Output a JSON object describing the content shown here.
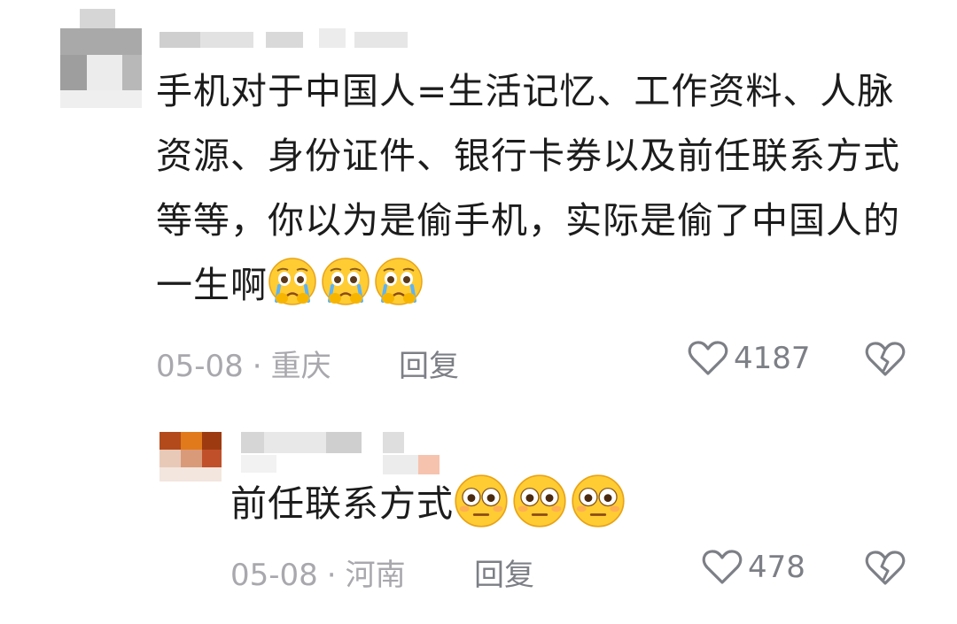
{
  "comments": [
    {
      "text": "手机对于中国人=生活记忆、工作资料、人脉资源、身份证件、银行卡券以及前任联系方式等等，你以为是偷手机，实际是偷了中国人的一生啊",
      "emoji": [
        "crying-pleading-face",
        "crying-pleading-face",
        "crying-pleading-face"
      ],
      "date": "05-08",
      "location": "重庆",
      "reply_label": "回复",
      "likes": "4187"
    },
    {
      "text": "前任联系方式",
      "emoji": [
        "flushed-face",
        "flushed-face",
        "flushed-face"
      ],
      "date": "05-08",
      "location": "河南",
      "reply_label": "回复",
      "likes": "478"
    }
  ],
  "separator": "·",
  "colors": {
    "meta": "#a8a8ad",
    "text": "#1c1c1c",
    "emoji_face": "#ffcc33"
  }
}
